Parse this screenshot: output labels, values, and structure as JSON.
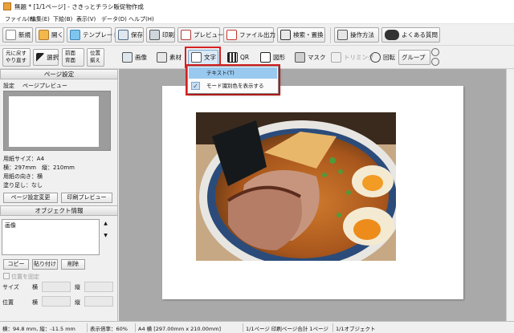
{
  "window": {
    "title": "無題 * [1/1ページ] - さきっとチラシ販促物作成"
  },
  "menu": [
    "ファイル(F)",
    "編集(E)",
    "下絵(B)",
    "表示(V)",
    "データ(D)",
    "ヘルプ(H)"
  ],
  "toolbar1": {
    "new": "新規",
    "open": "開く",
    "template": "テンプレート",
    "save": "保存",
    "print": "印刷",
    "preview": "プレビュー",
    "export": "ファイル出力",
    "search_replace": "検索・置換",
    "howto": "操作方法",
    "faq": "よくある質問"
  },
  "toolbar2": {
    "undo_line1": "元に戻す",
    "undo_line2": "やり直す",
    "select": "選択",
    "front_line1": "前面",
    "front_line2": "背面",
    "align_line1": "位置",
    "align_line2": "揃え",
    "image": "画像",
    "material": "素材",
    "text": "文字",
    "qr": "QR",
    "shape": "図形",
    "mask": "マスク",
    "trimming": "トリミング",
    "rotate": "回転",
    "group": "グループ"
  },
  "dropdown": {
    "items": [
      "テキスト(T)",
      "モード識別色を表示する"
    ],
    "checked_index": 1
  },
  "page_settings": {
    "header": "ページ設定",
    "tab_settings": "設定",
    "tab_preview": "ページプレビュー",
    "paper_size": "用紙サイズ：A4",
    "dimensions": "横：297mm　縦：210mm",
    "orientation": "用紙の向き：横",
    "bleed": "塗り足し：なし",
    "change_button": "ページ設定変更",
    "print_preview_button": "印刷プレビュー"
  },
  "object_info": {
    "header": "オブジェクト情報",
    "list_items": [
      "画像"
    ],
    "copy_button": "コピー",
    "paste_button": "貼り付け",
    "delete_button": "削除",
    "lock_position": "位置を固定",
    "size_label": "サイズ",
    "position_label": "位置",
    "width_label": "横",
    "height_label": "縦"
  },
  "status": {
    "width": "横：94.8 mm, 縦：-11.5 mm",
    "zoom": "表示倍率：60%",
    "paper": "A4 横 [297.00mm x 210.00mm]",
    "pages": "1/1ページ 印刷ページ合計 1ページ",
    "objects": "1/1オブジェクト"
  },
  "colors": {
    "accent": "#d42020",
    "highlight": "#99c9ef",
    "canvas_bg": "#a9a9a9"
  }
}
